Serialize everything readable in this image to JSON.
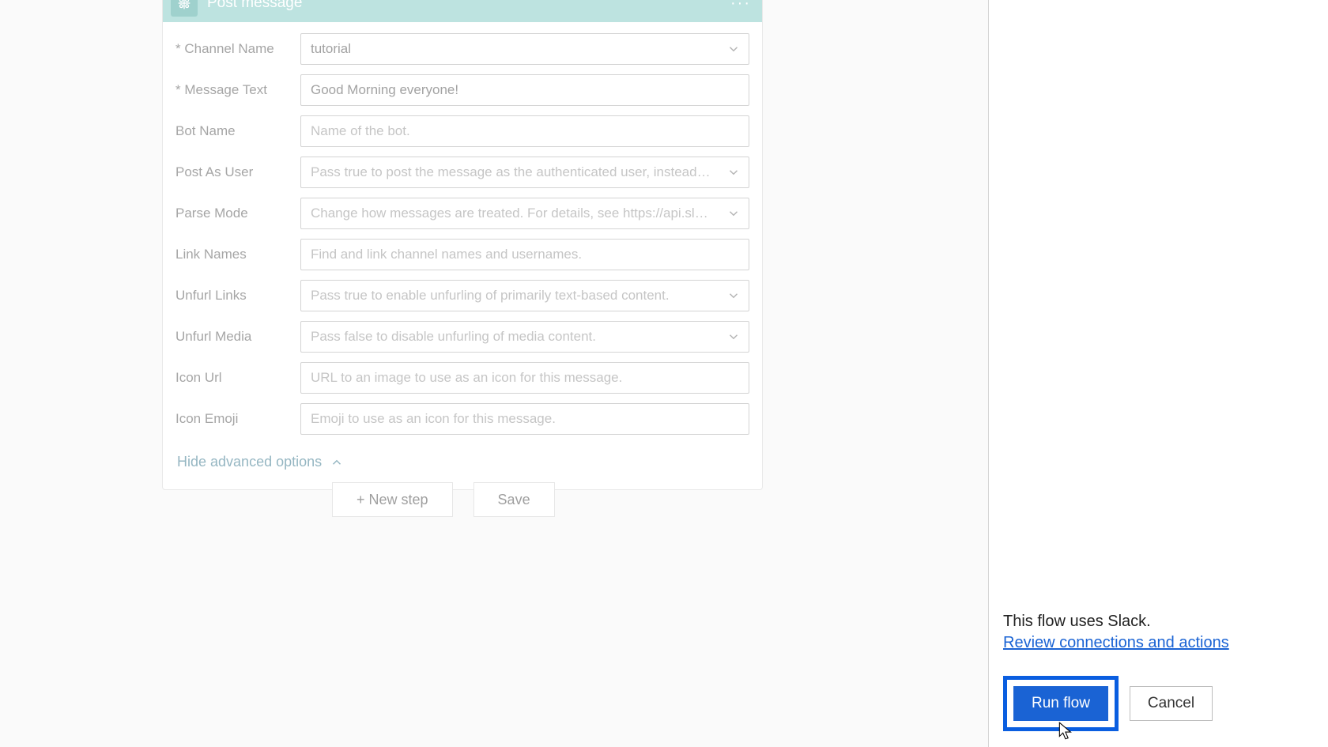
{
  "action": {
    "title": "Post message",
    "icon_name": "slack-icon",
    "fields": [
      {
        "label": "* Channel Name",
        "value": "tutorial",
        "placeholder": "",
        "has_dropdown": true,
        "is_placeholder": false
      },
      {
        "label": "* Message Text",
        "value": "Good Morning everyone!",
        "placeholder": "",
        "has_dropdown": false,
        "is_placeholder": false
      },
      {
        "label": "Bot Name",
        "value": "",
        "placeholder": "Name of the bot.",
        "has_dropdown": false,
        "is_placeholder": true
      },
      {
        "label": "Post As User",
        "value": "",
        "placeholder": "Pass true to post the message as the authenticated user, instead of as a b",
        "has_dropdown": true,
        "is_placeholder": true
      },
      {
        "label": "Parse Mode",
        "value": "",
        "placeholder": "Change how messages are treated. For details, see https://api.slack.com/c",
        "has_dropdown": true,
        "is_placeholder": true
      },
      {
        "label": "Link Names",
        "value": "",
        "placeholder": "Find and link channel names and usernames.",
        "has_dropdown": false,
        "is_placeholder": true
      },
      {
        "label": "Unfurl Links",
        "value": "",
        "placeholder": "Pass true to enable unfurling of primarily text-based content.",
        "has_dropdown": true,
        "is_placeholder": true
      },
      {
        "label": "Unfurl Media",
        "value": "",
        "placeholder": "Pass false to disable unfurling of media content.",
        "has_dropdown": true,
        "is_placeholder": true
      },
      {
        "label": "Icon Url",
        "value": "",
        "placeholder": "URL to an image to use as an icon for this message.",
        "has_dropdown": false,
        "is_placeholder": true
      },
      {
        "label": "Icon Emoji",
        "value": "",
        "placeholder": "Emoji to use as an icon for this message.",
        "has_dropdown": false,
        "is_placeholder": true
      }
    ],
    "hide_advanced_label": "Hide advanced options"
  },
  "buttons": {
    "new_step": "+ New step",
    "save": "Save"
  },
  "panel": {
    "info_text": "This flow uses Slack.",
    "review_link": "Review connections and actions",
    "run_flow": "Run flow",
    "cancel": "Cancel"
  }
}
